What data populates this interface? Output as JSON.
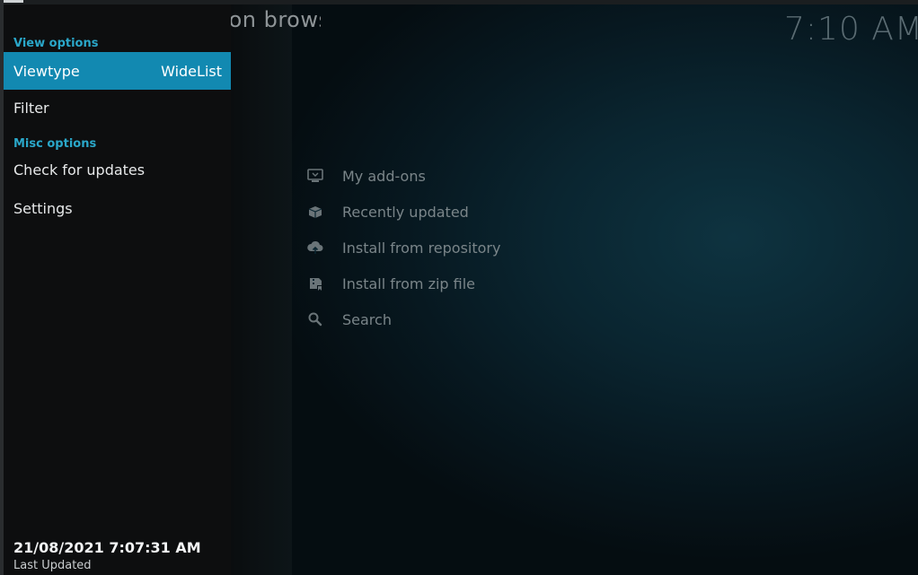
{
  "background": {
    "page_title": "Add-on browser",
    "clock": "7:10 AM"
  },
  "addon_menu": {
    "items": [
      {
        "label": "My add-ons",
        "icon": "monitor-box-icon"
      },
      {
        "label": "Recently updated",
        "icon": "open-box-icon"
      },
      {
        "label": "Install from repository",
        "icon": "cloud-upload-icon"
      },
      {
        "label": "Install from zip file",
        "icon": "zip-file-icon"
      },
      {
        "label": "Search",
        "icon": "search-icon"
      }
    ]
  },
  "side_panel": {
    "view_options_header": "View options",
    "viewtype_label": "Viewtype",
    "viewtype_value": "WideList",
    "filter_label": "Filter",
    "misc_options_header": "Misc options",
    "check_updates_label": "Check for updates",
    "settings_label": "Settings",
    "last_updated_value": "21/08/2021 7:07:31 AM",
    "last_updated_label": "Last Updated"
  },
  "colors": {
    "accent": "#1289b1",
    "header": "#2aa7c9",
    "panel": "#0d0e0f"
  }
}
